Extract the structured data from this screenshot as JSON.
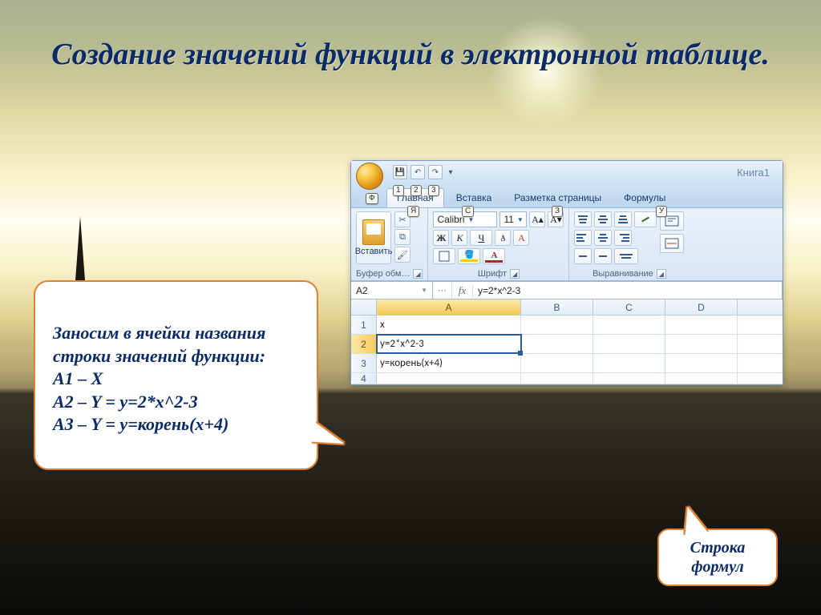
{
  "slide": {
    "title": "Создание значений функций в электронной таблице."
  },
  "bubble_left": {
    "line1": "Заносим в ячейки названия строки значений функции:",
    "line2": "A1 – X",
    "line3": "A2 – Y = y=2*x^2-3",
    "line4": "A3 – Y = y=корень(x+4)"
  },
  "bubble_right": {
    "text": "Строка формул"
  },
  "excel": {
    "doc_title": "Книга1",
    "orb_key": "Ф",
    "qat_keys": [
      "1",
      "2",
      "3"
    ],
    "tabs": {
      "home": "Главная",
      "insert": "Вставка",
      "layout": "Разметка страницы",
      "formulas": "Формулы"
    },
    "tab_keys": {
      "home": "Я",
      "insert": "С",
      "layout": "З",
      "formulas": "У"
    },
    "ribbon": {
      "paste_label": "Вставить",
      "clipboard_label": "Буфер обм…",
      "font_label": "Шрифт",
      "align_label": "Выравнивание",
      "font_name": "Calibri",
      "font_size": "11",
      "bold": "Ж",
      "italic": "К",
      "underline": "Ч"
    },
    "formula_bar": {
      "name_box": "A2",
      "fx_label": "fx",
      "value": "y=2*x^2-3"
    },
    "grid": {
      "col_headers": [
        "A",
        "B",
        "C",
        "D"
      ],
      "rows": [
        {
          "num": "1",
          "A": "x"
        },
        {
          "num": "2",
          "A": "y=2*x^2-3",
          "active": true
        },
        {
          "num": "3",
          "A": "y=корень(x+4)"
        },
        {
          "num": "4",
          "A": ""
        }
      ]
    }
  }
}
